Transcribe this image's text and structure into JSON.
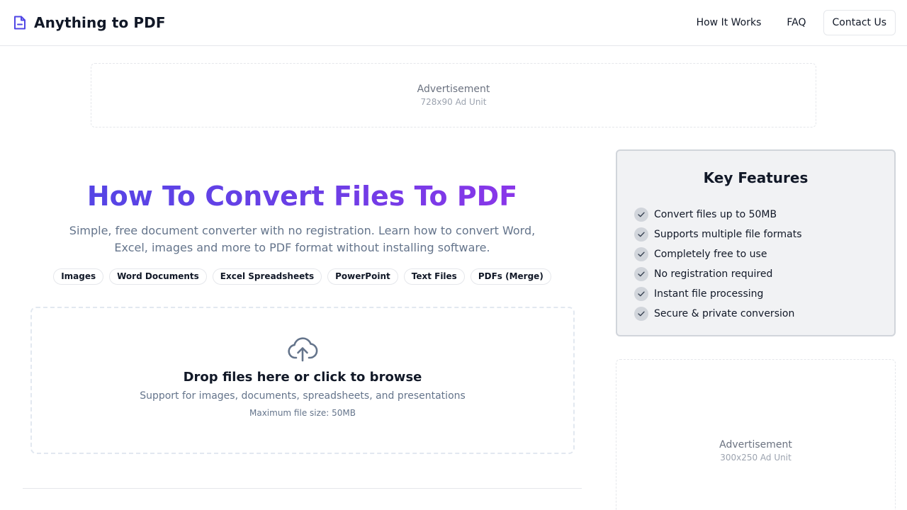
{
  "header": {
    "brand_name": "Anything to PDF",
    "brand_icon": "file-icon",
    "nav": {
      "how_it_works": "How It Works",
      "faq": "FAQ",
      "contact": "Contact Us"
    }
  },
  "ad_top": {
    "label": "Advertisement",
    "size": "728x90 Ad Unit"
  },
  "hero": {
    "title": "How To Convert Files To PDF",
    "subtitle": "Simple, free document converter with no registration. Learn how to convert Word, Excel, images and more to PDF format without installing software.",
    "tags": [
      "Images",
      "Word Documents",
      "Excel Spreadsheets",
      "PowerPoint",
      "Text Files",
      "PDFs (Merge)"
    ]
  },
  "dropzone": {
    "icon": "cloud-upload-icon",
    "title": "Drop files here or click to browse",
    "subtitle": "Support for images, documents, spreadsheets, and presentations",
    "max_size": "Maximum file size: 50MB"
  },
  "features": {
    "title": "Key Features",
    "items": [
      "Convert files up to 50MB",
      "Supports multiple file formats",
      "Completely free to use",
      "No registration required",
      "Instant file processing",
      "Secure & private conversion"
    ]
  },
  "ad_side": {
    "label": "Advertisement",
    "size": "300x250 Ad Unit"
  },
  "colors": {
    "accent_start": "#4f46e5",
    "accent_end": "#9333ea",
    "muted_text": "#64748b",
    "border": "#e5e7eb"
  }
}
